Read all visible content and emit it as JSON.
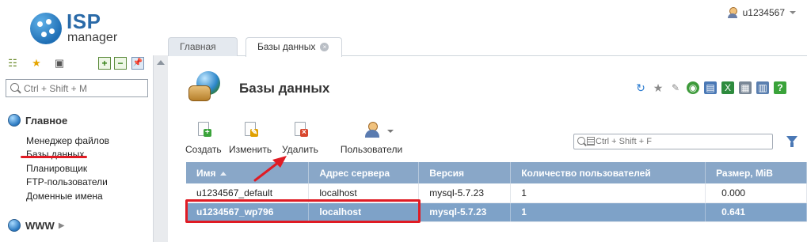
{
  "app": {
    "logo_line1": "ISP",
    "logo_line2": "manager",
    "user": "u1234567"
  },
  "sidebar": {
    "search_placeholder": "Ctrl + Shift + M",
    "section_main": "Главное",
    "items": [
      {
        "label": "Менеджер файлов"
      },
      {
        "label": "Базы данных"
      },
      {
        "label": "Планировщик"
      },
      {
        "label": "FTP-пользователи"
      },
      {
        "label": "Доменные имена"
      }
    ],
    "section_www": "WWW"
  },
  "tabs": [
    {
      "label": "Главная"
    },
    {
      "label": "Базы данных",
      "close": "×"
    }
  ],
  "page": {
    "title": "Базы данных",
    "actions": {
      "create": "Создать",
      "edit": "Изменить",
      "delete": "Удалить",
      "users": "Пользователи"
    },
    "table_search_placeholder": "Ctrl + Shift + F"
  },
  "table": {
    "columns": [
      "Имя",
      "Адрес сервера",
      "Версия",
      "Количество пользователей",
      "Размер, MiB"
    ],
    "rows": [
      {
        "name": "u1234567_default",
        "server": "localhost",
        "version": "mysql-5.7.23",
        "users": "1",
        "size": "0.000"
      },
      {
        "name": "u1234567_wp796",
        "server": "localhost",
        "version": "mysql-5.7.23",
        "users": "1",
        "size": "0.641"
      }
    ],
    "selected_row": 1
  },
  "colors": {
    "brand": "#2a6aa8",
    "header": "#89a7c8",
    "selected": "#7ea2c8",
    "annotation": "#e01b24"
  }
}
